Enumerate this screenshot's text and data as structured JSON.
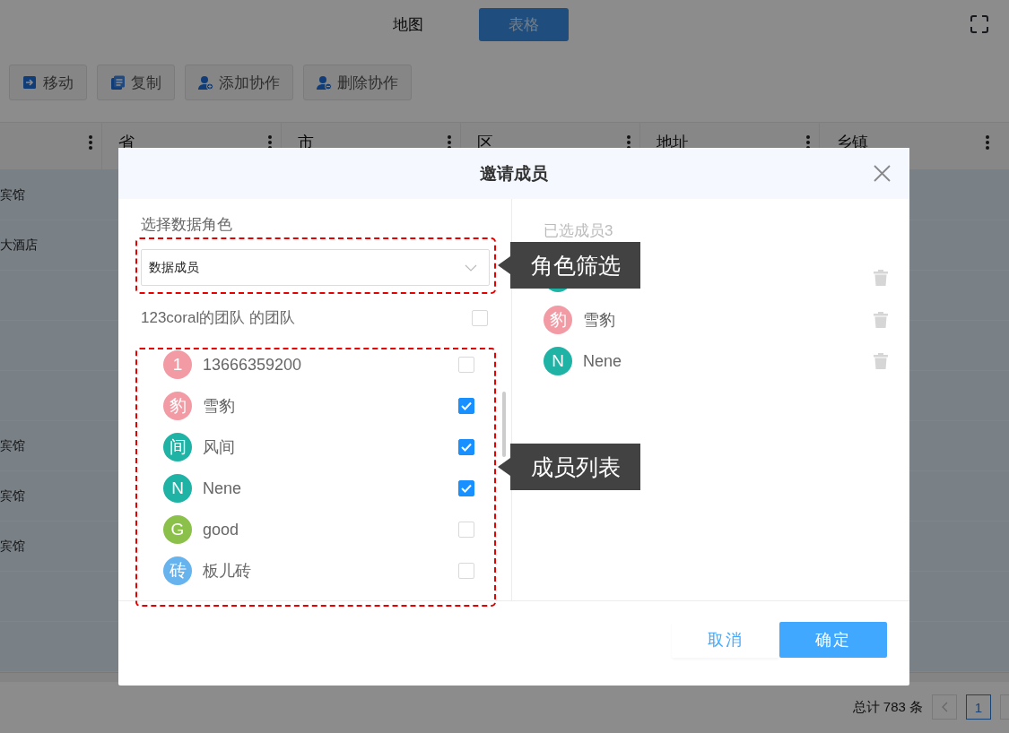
{
  "top_bar": {
    "tabs": [
      {
        "label": "地图",
        "selected": false
      },
      {
        "label": "表格",
        "selected": true
      }
    ]
  },
  "toolbar": {
    "buttons": [
      {
        "label": "移动",
        "kind": "move"
      },
      {
        "label": "复制",
        "kind": "copy"
      },
      {
        "label": "添加协作",
        "kind": "add-user"
      },
      {
        "label": "删除协作",
        "kind": "remove-user"
      }
    ]
  },
  "table": {
    "columns": [
      "省",
      "市",
      "区",
      "地址",
      "乡镇"
    ],
    "rows": [
      {
        "cell": "宾馆",
        "selected": true
      },
      {
        "cell": "大酒店",
        "selected": true
      },
      {
        "selected": true
      },
      {
        "selected": true
      },
      {
        "selected": true
      },
      {
        "cell": "宾馆",
        "selected": true
      },
      {
        "cell": "宾馆",
        "selected": true
      },
      {
        "cell": "宾馆",
        "selected": true
      },
      {
        "selected": true
      },
      {
        "selected": true
      }
    ]
  },
  "pagination": {
    "total": "总计 783 条",
    "pages": [
      {
        "label": "1",
        "selected": true
      }
    ]
  },
  "dialog": {
    "title": "邀请成员",
    "role_label": "选择数据角色",
    "role_select": {
      "value": "数据成员"
    },
    "team": {
      "label": "123coral的团队 的团队",
      "checked": false
    },
    "members": [
      {
        "initial": "1",
        "name": "13666359200",
        "color": "#f29ba5",
        "checked": false
      },
      {
        "initial": "豹",
        "name": "雪豹",
        "color": "#f29ba5",
        "checked": true
      },
      {
        "initial": "间",
        "name": "风间",
        "color": "#1fb3a5",
        "checked": true
      },
      {
        "initial": "N",
        "name": "Nene",
        "color": "#1fb3a5",
        "checked": true
      },
      {
        "initial": "G",
        "name": "good",
        "color": "#8bc14a",
        "checked": false
      },
      {
        "initial": "砖",
        "name": "板儿砖",
        "color": "#66b3ee",
        "checked": false
      }
    ],
    "selected_title": "已选成员3",
    "selected_members": [
      {
        "color": "#1fb3a5"
      },
      {
        "initial": "豹",
        "name": "雪豹",
        "color": "#f29ba5"
      },
      {
        "initial": "N",
        "name": "Nene",
        "color": "#1fb3a5"
      }
    ],
    "buttons": [
      {
        "label": "取消",
        "kind": "cancel"
      },
      {
        "label": "确定",
        "kind": "primary"
      }
    ]
  },
  "annotations": [
    {
      "label": "角色筛选"
    },
    {
      "label": "成员列表"
    }
  ]
}
